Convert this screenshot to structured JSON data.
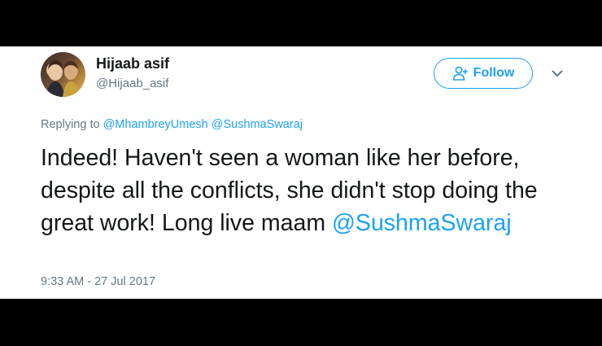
{
  "tweet": {
    "author": {
      "name": "Hijaab asif",
      "handle": "@Hijaab_asif"
    },
    "follow_label": "Follow",
    "replying_prefix": "Replying to",
    "replying_to": [
      "@MhambreyUmesh",
      "@SushmaSwaraj"
    ],
    "text": "Indeed! Haven't seen a woman like her before, despite all the conflicts, she didn't stop doing the great work! Long live maam",
    "text_mention": "@SushmaSwaraj",
    "timestamp": "9:33 AM - 27 Jul 2017"
  },
  "icons": {
    "follow": "add-user-icon",
    "menu": "chevron-down-icon"
  },
  "colors": {
    "accent": "#1da1f2",
    "text": "#14171a",
    "muted": "#657786",
    "frame": "#000000"
  }
}
